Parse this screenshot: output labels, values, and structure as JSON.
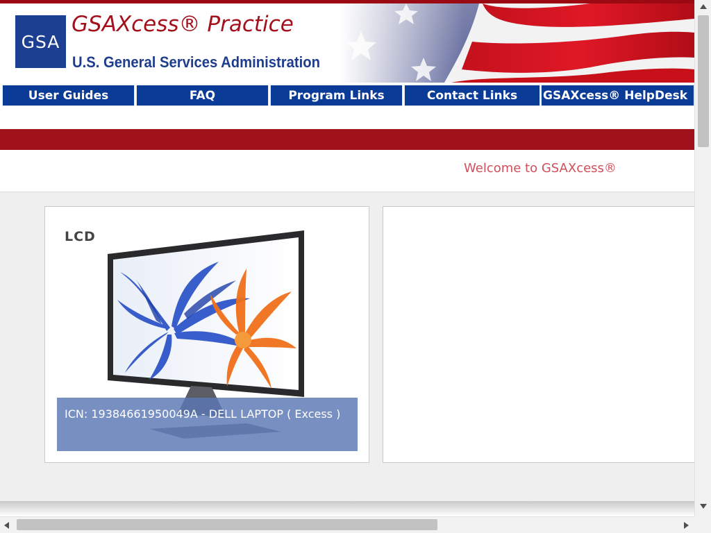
{
  "header": {
    "logo_text": "GSA",
    "title": "GSAXcess®  Practice",
    "subtitle": "U.S. General Services Administration"
  },
  "nav": {
    "items": [
      {
        "label": "User Guides"
      },
      {
        "label": "FAQ"
      },
      {
        "label": "Program Links"
      },
      {
        "label": "Contact Links"
      },
      {
        "label": "GSAXcess® HelpDesk"
      }
    ]
  },
  "welcome_text": "Welcome to GSAXcess®",
  "featured": {
    "image_label": "LCD",
    "caption": "ICN: 19384661950049A - DELL LAPTOP ( Excess )"
  },
  "colors": {
    "brand_red": "#a0121b",
    "brand_blue": "#0a3b97",
    "welcome": "#d04f5c"
  }
}
